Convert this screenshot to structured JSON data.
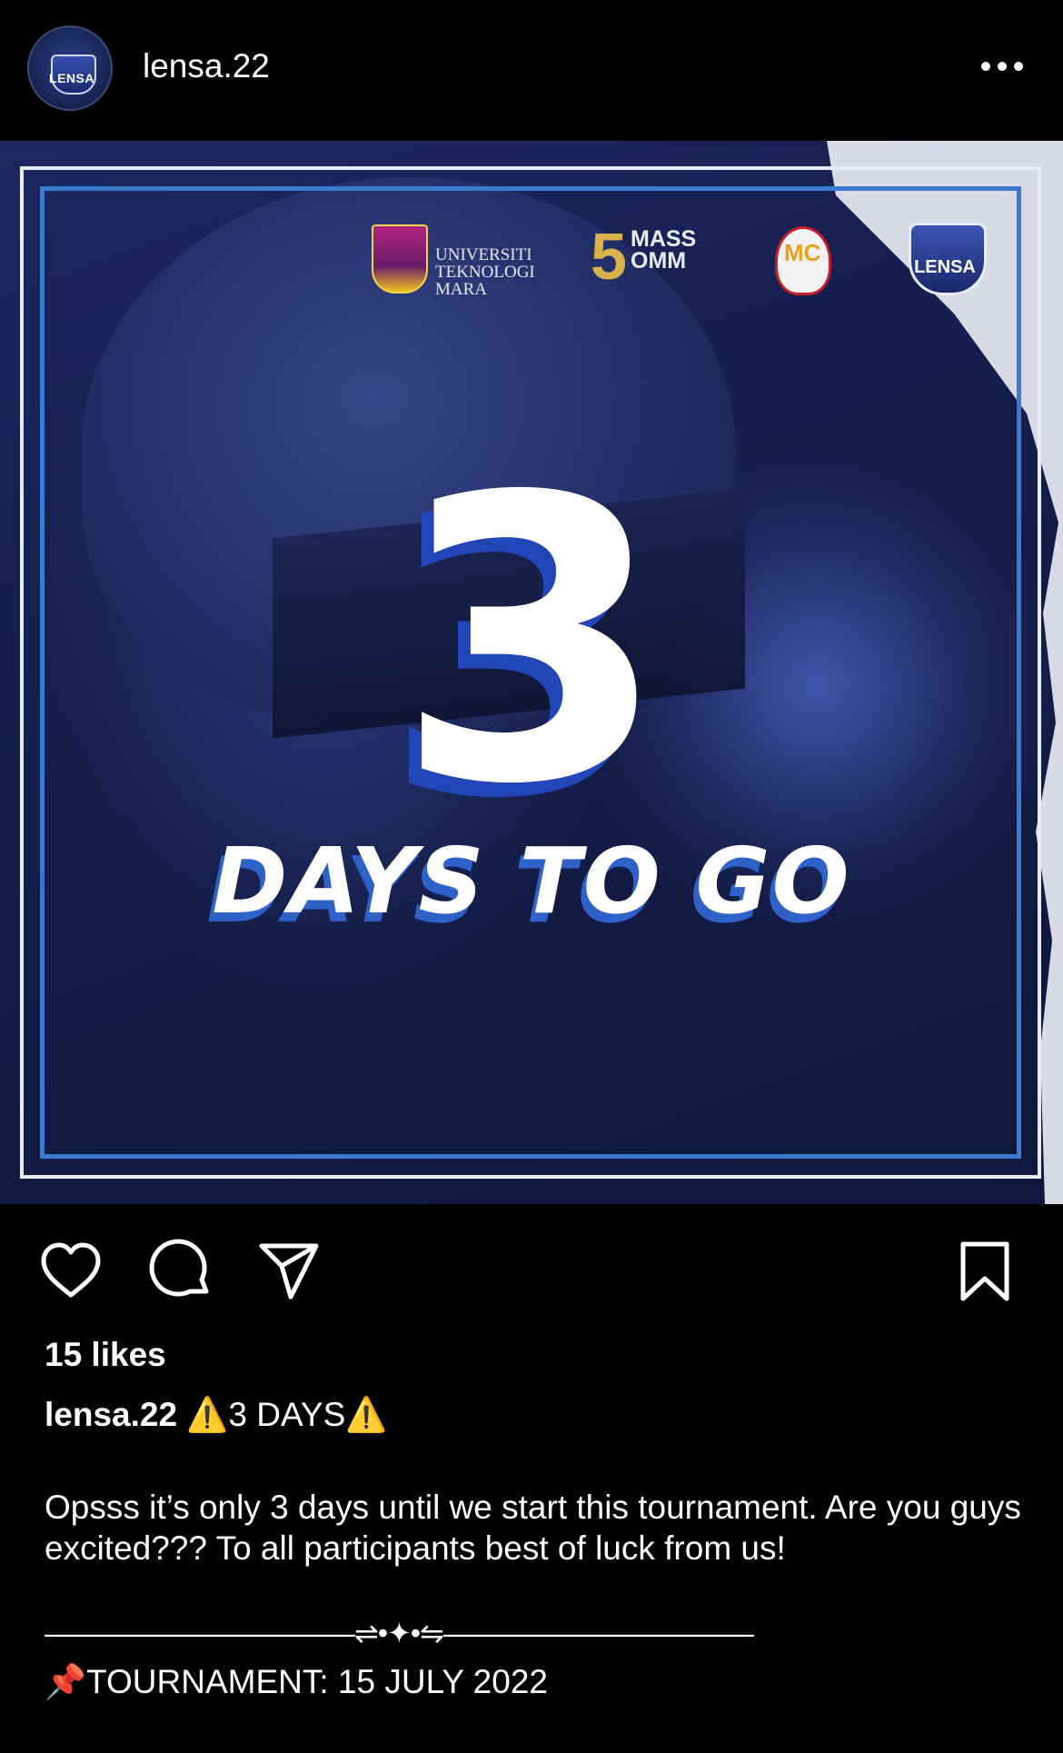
{
  "header": {
    "username": "lensa.22",
    "avatar_text": "LENSA",
    "more_icon": "more-horizontal-icon"
  },
  "post_image": {
    "logos": {
      "uitm": "UNIVERSITI TEKNOLOGI MARA",
      "uitm_line1": "UNIVERSITI",
      "uitm_line2": "TEKNOLOGI",
      "uitm_line3": "MARA",
      "mass_number": "5",
      "mass_line1": "MASS",
      "mass_line2": "OMM",
      "mc": "MC",
      "lensa": "LENSA"
    },
    "countdown_number": "3",
    "countdown_text": "DAYS TO GO",
    "accent_color": "#2146b8"
  },
  "actions": {
    "like_icon": "heart-icon",
    "comment_icon": "comment-icon",
    "share_icon": "send-icon",
    "save_icon": "bookmark-icon"
  },
  "likes": "15 likes",
  "caption": {
    "username": "lensa.22",
    "warn_emoji": "⚠️",
    "headline": "3 DAYS",
    "body": "Opsss it’s only 3 days until we start this tournament. Are you guys excited??? To all participants best of luck from us!",
    "divider": "———————————⇌•✦•⇋———————————",
    "pin_emoji": "📌",
    "tournament": "TOURNAMENT: 15 JULY 2022"
  }
}
